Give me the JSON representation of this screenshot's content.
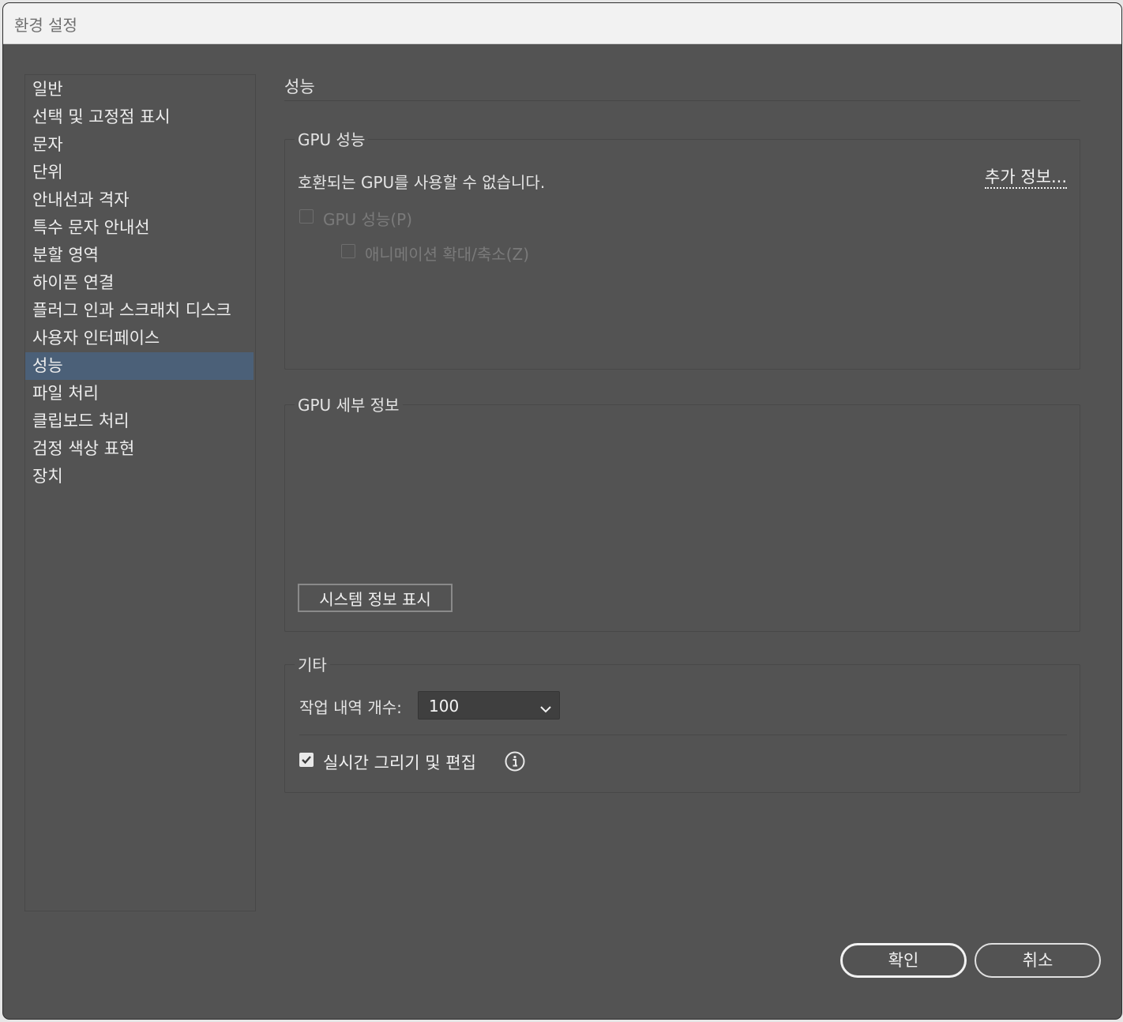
{
  "window": {
    "title": "환경 설정"
  },
  "sidebar": {
    "items": [
      {
        "label": "일반"
      },
      {
        "label": "선택 및 고정점 표시"
      },
      {
        "label": "문자"
      },
      {
        "label": "단위"
      },
      {
        "label": "안내선과 격자"
      },
      {
        "label": "특수 문자 안내선"
      },
      {
        "label": "분할 영역"
      },
      {
        "label": "하이픈 연결"
      },
      {
        "label": "플러그 인과 스크래치 디스크"
      },
      {
        "label": "사용자 인터페이스"
      },
      {
        "label": "성능",
        "selected": true
      },
      {
        "label": "파일 처리"
      },
      {
        "label": "클립보드 처리"
      },
      {
        "label": "검정 색상 표현"
      },
      {
        "label": "장치"
      }
    ]
  },
  "main": {
    "heading": "성능",
    "gpu_performance": {
      "legend": "GPU 성능",
      "message": "호환되는 GPU를 사용할 수 없습니다.",
      "more_info_link": "추가 정보...",
      "gpu_checkbox_label": "GPU 성능(P)",
      "gpu_checkbox_checked": false,
      "animated_zoom_label": "애니메이션 확대/축소(Z)",
      "animated_zoom_checked": false
    },
    "gpu_details": {
      "legend": "GPU 세부 정보",
      "system_info_button": "시스템 정보 표시"
    },
    "misc": {
      "legend": "기타",
      "history_label": "작업 내역 개수:",
      "history_value": "100",
      "live_drawing_label": "실시간 그리기 및 편집",
      "live_drawing_checked": true
    }
  },
  "footer": {
    "ok_label": "확인",
    "cancel_label": "취소"
  },
  "colors": {
    "dialog_bg": "#535353",
    "selected_item_bg": "#4b6078",
    "title_bar_bg": "#f2f2f2"
  }
}
